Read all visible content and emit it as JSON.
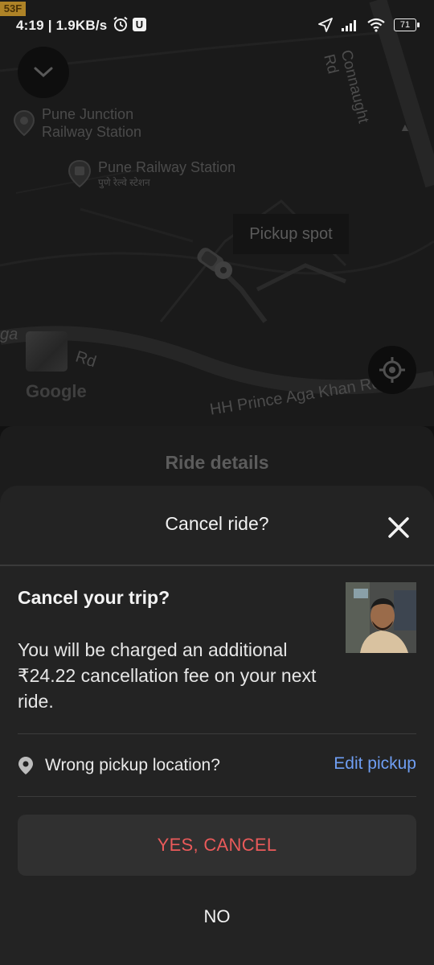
{
  "status_bar": {
    "time": "4:19",
    "speed": "1.9KB/s",
    "badge": "U",
    "battery": "71",
    "carrier_tag": "53F",
    "icons": [
      "alarm-icon",
      "navigation-arrow-icon",
      "signal-icon",
      "wifi-icon",
      "battery-icon"
    ]
  },
  "map": {
    "road_connaught": "Connaught Rd",
    "poi_junction_line1": "Pune Junction",
    "poi_junction_line2": "Railway Station",
    "poi_station": "Pune Railway Station",
    "poi_station_hindi": "पुणे रेल्वे स्टेशन",
    "pickup_spot": "Pickup spot",
    "road_aga": "ga",
    "road_rd": "Rd",
    "road_hh": "HH Prince Aga Khan Rd",
    "google": "Google"
  },
  "ride_details": {
    "title": "Ride details"
  },
  "cancel_sheet": {
    "title": "Cancel ride?",
    "trip_title": "Cancel your trip?",
    "trip_body": "You will be charged an additional ₹24.22 cancellation fee on your next ride.",
    "pickup_question": "Wrong pickup location?",
    "edit_pickup": "Edit pickup",
    "yes_cancel": "YES, CANCEL",
    "no": "NO"
  },
  "colors": {
    "accent_blue": "#6f9ef3",
    "cancel_red": "#ea5a5a",
    "sheet_bg": "#232323"
  }
}
